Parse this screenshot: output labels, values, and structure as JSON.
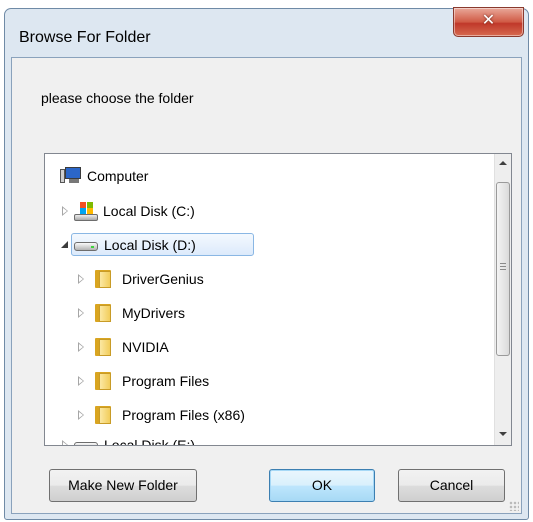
{
  "window": {
    "title": "Browse For Folder",
    "close_glyph": "✕"
  },
  "instruction": "please choose the folder",
  "tree": {
    "items": [
      {
        "label": "Computer",
        "icon": "computer-icon",
        "expander": "none"
      },
      {
        "label": "Local Disk (C:)",
        "icon": "windows-disk-icon",
        "expander": "collapsed"
      },
      {
        "label": "Local Disk (D:)",
        "icon": "disk-icon",
        "expander": "expanded",
        "selected": true
      },
      {
        "label": "DriverGenius",
        "icon": "folder-icon",
        "expander": "collapsed"
      },
      {
        "label": "MyDrivers",
        "icon": "folder-icon",
        "expander": "collapsed"
      },
      {
        "label": "NVIDIA",
        "icon": "folder-icon",
        "expander": "collapsed"
      },
      {
        "label": "Program Files",
        "icon": "folder-icon",
        "expander": "collapsed"
      },
      {
        "label": "Program Files (x86)",
        "icon": "folder-icon",
        "expander": "collapsed"
      },
      {
        "label": "Local Disk (E:)",
        "icon": "disk-icon",
        "expander": "collapsed"
      }
    ]
  },
  "buttons": {
    "make_new_folder": "Make New Folder",
    "ok": "OK",
    "cancel": "Cancel"
  },
  "colors": {
    "title_bar": "#dde7f1",
    "close_button": "#c7432f",
    "selection_border": "#8ab7e4",
    "default_button_border": "#3c7fb1"
  }
}
